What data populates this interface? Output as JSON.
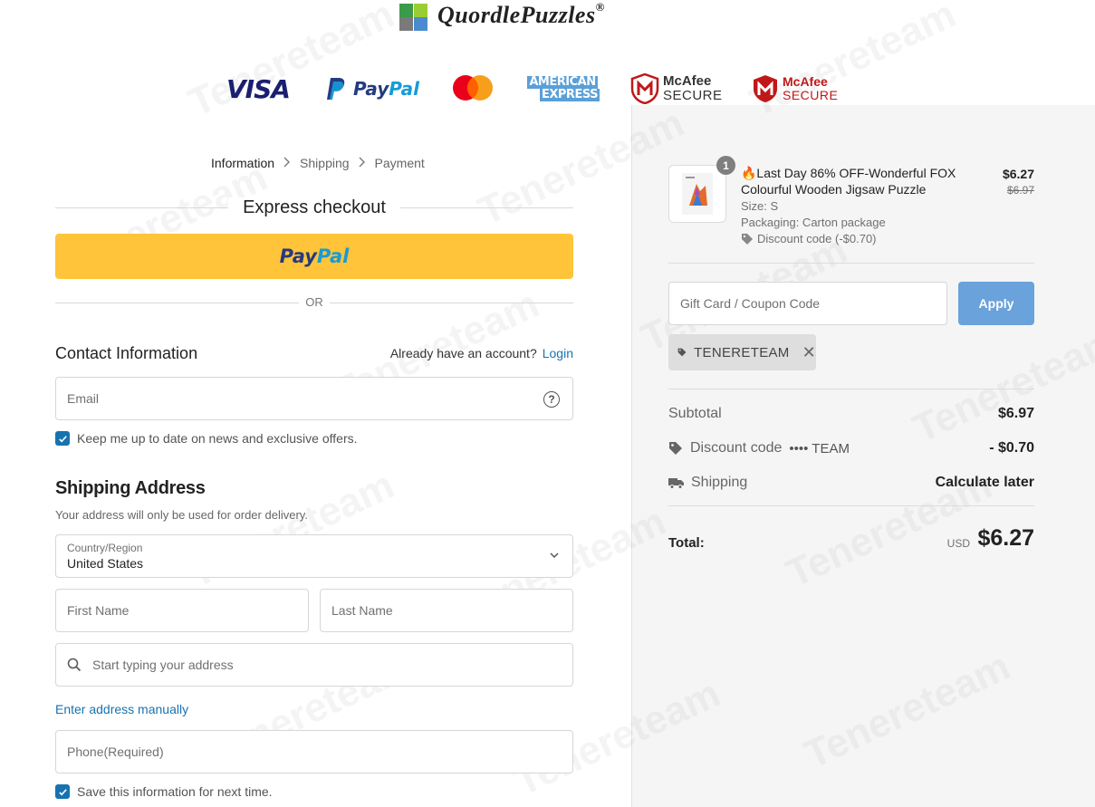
{
  "brand": {
    "name": "QuordlePuzzles",
    "registered": "®"
  },
  "payment_logos": [
    {
      "name": "visa",
      "label": "VISA"
    },
    {
      "name": "paypal",
      "label_a": "Pay",
      "label_b": "Pal"
    },
    {
      "name": "mastercard",
      "label": ""
    },
    {
      "name": "american-express",
      "label_a": "AMERICAN",
      "label_b": "EXPRESS"
    },
    {
      "name": "mcafee-secure-1",
      "label_a": "McAfee",
      "label_b": "SECURE"
    },
    {
      "name": "mcafee-secure-2",
      "label_a": "McAfee",
      "label_b": "SECURE"
    }
  ],
  "breadcrumb": {
    "items": [
      "Information",
      "Shipping",
      "Payment"
    ],
    "separator": ">"
  },
  "express": {
    "title": "Express checkout",
    "paypal_a": "Pay",
    "paypal_b": "Pal",
    "or": "OR"
  },
  "contact": {
    "title": "Contact Information",
    "account_prompt": "Already have an account?",
    "login": "Login",
    "email_placeholder": "Email",
    "newsletter_label": "Keep me up to date on news and exclusive offers.",
    "newsletter_checked": true
  },
  "shipping": {
    "title": "Shipping Address",
    "subtitle": "Your address will only be used for order delivery.",
    "country_label": "Country/Region",
    "country_value": "United States",
    "first_name_placeholder": "First Name",
    "last_name_placeholder": "Last Name",
    "address_placeholder": "Start typing your address",
    "manual_link": "Enter address manually",
    "phone_placeholder": "Phone(Required)",
    "save_label": "Save this information for next time.",
    "save_checked": true
  },
  "summary": {
    "item": {
      "quantity": "1",
      "title": "🔥Last Day 86% OFF-Wonderful FOX Colourful Wooden Jigsaw Puzzle",
      "size": "Size: S",
      "packaging": "Packaging: Carton package",
      "discount": "Discount code (-$0.70)",
      "price": "$6.27",
      "old_price": "$6.97"
    },
    "coupon_placeholder": "Gift Card / Coupon Code",
    "apply": "Apply",
    "applied_code": "TENERETEAM",
    "subtotal_label": "Subtotal",
    "subtotal_value": "$6.97",
    "discount_label": "Discount code",
    "discount_code_masked": "•••• TEAM",
    "discount_value": "- $0.70",
    "shipping_label": "Shipping",
    "shipping_value": "Calculate later",
    "total_label": "Total:",
    "currency": "USD",
    "total_value": "$6.27"
  },
  "watermark": "Tenereteam",
  "colors": {
    "accent": "#1773b0",
    "paypal_yellow": "#ffc43a",
    "apply_button": "#6aa2dc",
    "summary_bg": "#f5f5f5"
  }
}
